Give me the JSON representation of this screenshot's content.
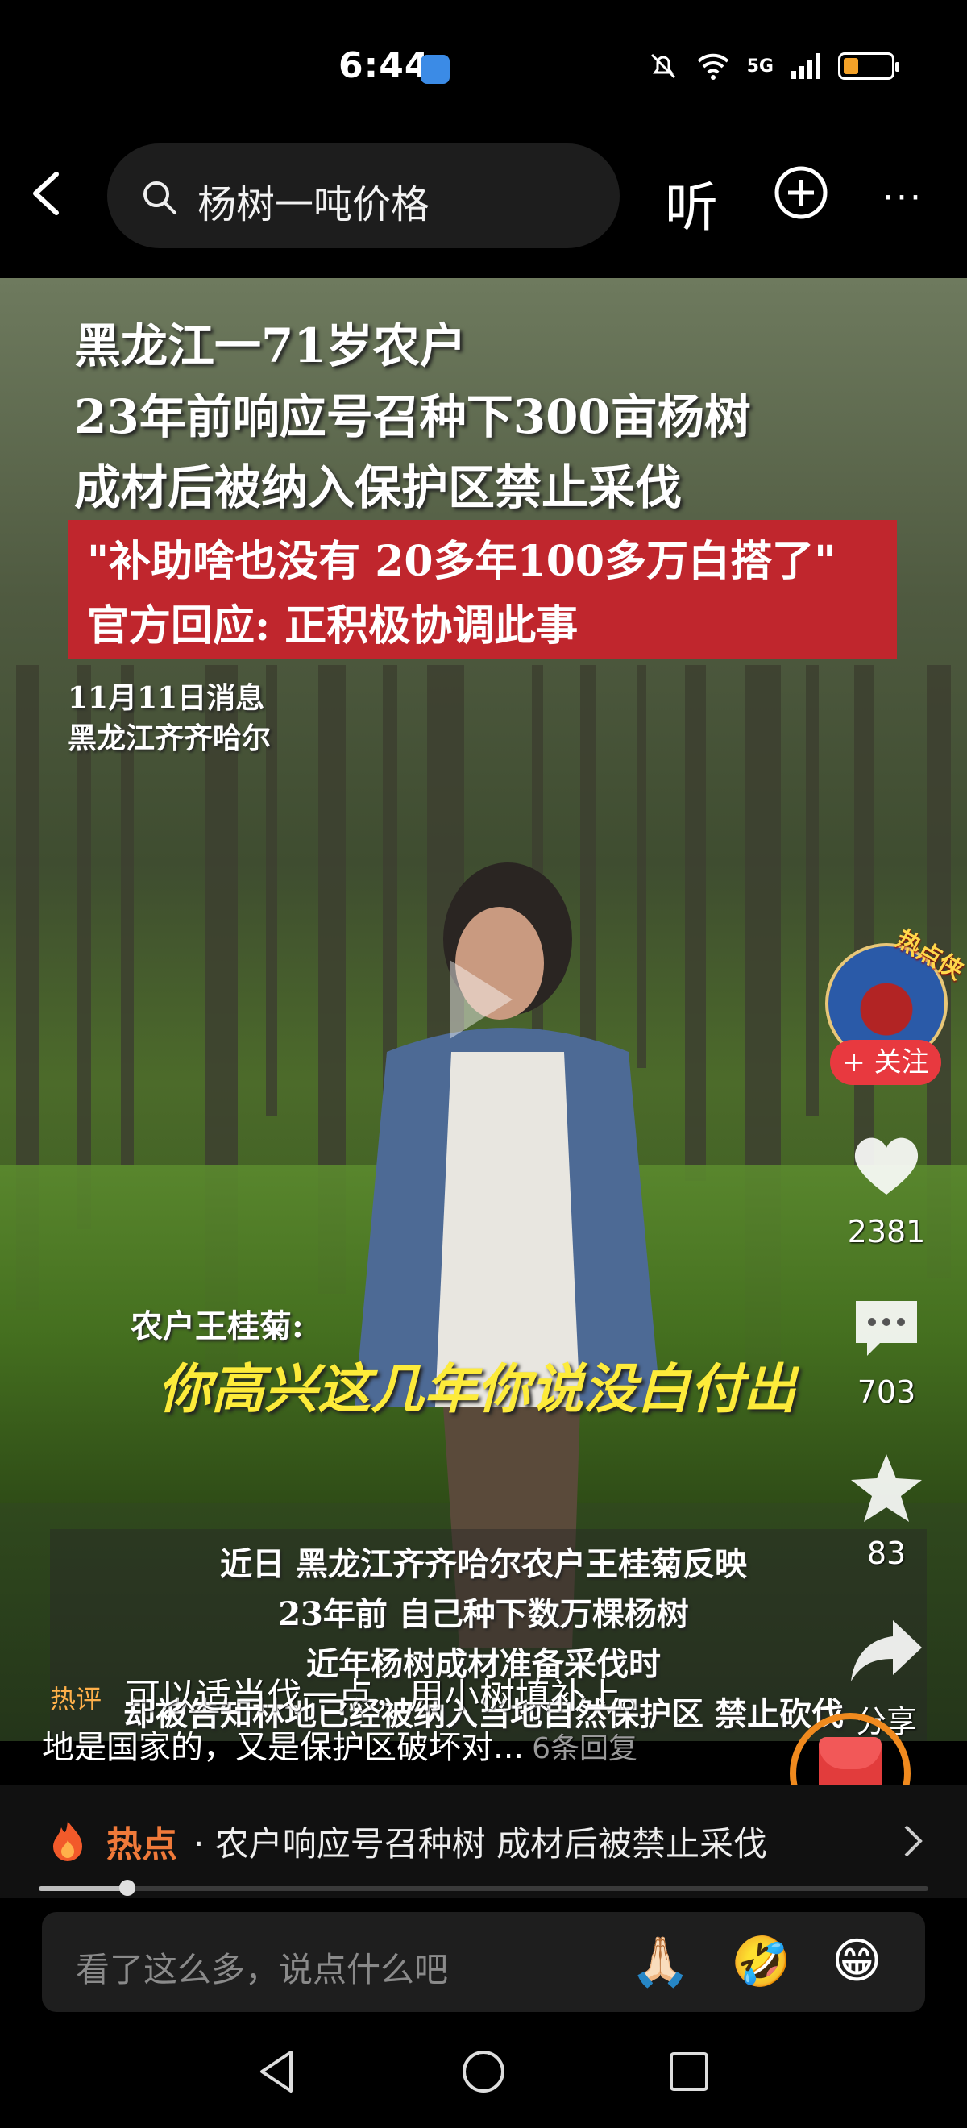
{
  "status_bar": {
    "time": "6:44",
    "network": "5G",
    "battery_percent": 20
  },
  "top_bar": {
    "search_query": "杨树一吨价格",
    "listen_label": "听",
    "back_icon": "chevron-left-icon",
    "add_icon": "plus-circle-icon",
    "more_icon": "more-horizontal-icon"
  },
  "video": {
    "headline": [
      "黑龙江一71岁农户",
      "23年前响应号召种下300亩杨树",
      "成材后被纳入保护区禁止采伐"
    ],
    "red_banner": [
      "\"补助啥也没有 20多年100多万白搭了\"",
      "官方回应: 正积极协调此事"
    ],
    "dateline": [
      "11月11日消息",
      "黑龙江齐齐哈尔"
    ],
    "speaker_label": "农户王桂菊:",
    "speaker_quote": "你高兴这几年你说没白付出",
    "caption_lines": [
      "近日 黑龙江齐齐哈尔农户王桂菊反映",
      "23年前 自己种下数万棵杨树",
      "近年杨树成材准备采伐时",
      "却被告知林地已经被纳入当地自然保护区 禁止砍伐"
    ]
  },
  "right_rail": {
    "avatar_tag": "热点侠",
    "follow_label": "+ 关注",
    "likes": "2381",
    "comments": "703",
    "favorites": "83",
    "share_label": "分享"
  },
  "comment_overlay": {
    "hot_label": "热评",
    "line1": "可以适当伐一点，用小树填补上。",
    "line2": "地是国家的，又是保护区破坏对...",
    "replies": "6条回复"
  },
  "hot_topic": {
    "tag": "热点",
    "text": "· 农户响应号召种树 成材后被禁止采伐"
  },
  "progress": {
    "fraction": 0.1
  },
  "comment_input": {
    "placeholder": "看了这么多，说点什么吧",
    "emojis": [
      "🙏🏻",
      "🤣",
      "😁"
    ]
  },
  "colors": {
    "red": "#c0262d",
    "follow": "#e8393f",
    "quote_yellow": "#fdeb3a",
    "hot_orange": "#f07a3a"
  }
}
